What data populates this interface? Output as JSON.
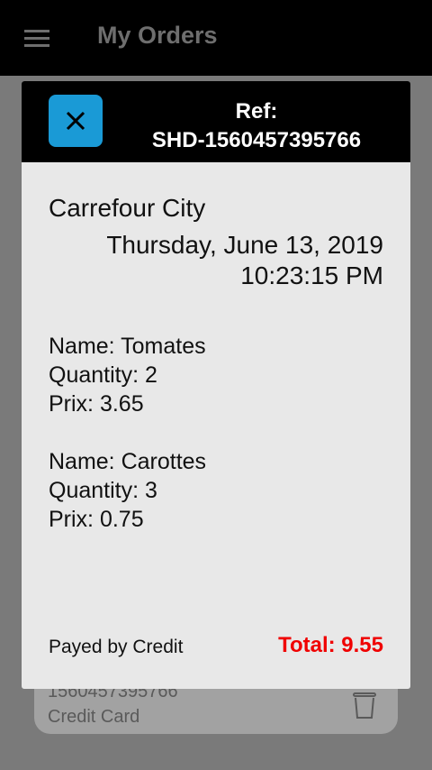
{
  "appbar": {
    "title": "My Orders",
    "menu_icon": "hamburger-menu-icon"
  },
  "background_card": {
    "ref": "1560457395766",
    "payment": "Credit Card",
    "icon": "trash-icon"
  },
  "dialog": {
    "close_icon": "close-icon",
    "ref_label": "Ref:",
    "ref_value": "SHD-1560457395766",
    "store": "Carrefour City",
    "date": "Thursday, June 13, 2019",
    "time": "10:23:15 PM",
    "items": [
      {
        "name": "Name: Tomates",
        "quantity": "Quantity: 2",
        "price": "Prix: 3.65"
      },
      {
        "name": "Name: Carottes",
        "quantity": "Quantity: 3",
        "price": "Prix: 0.75"
      }
    ],
    "payment": "Payed by Credit",
    "total": "Total: 9.55"
  },
  "colors": {
    "accent": "#1a9ad6",
    "total": "#f00000",
    "header": "#000000"
  }
}
